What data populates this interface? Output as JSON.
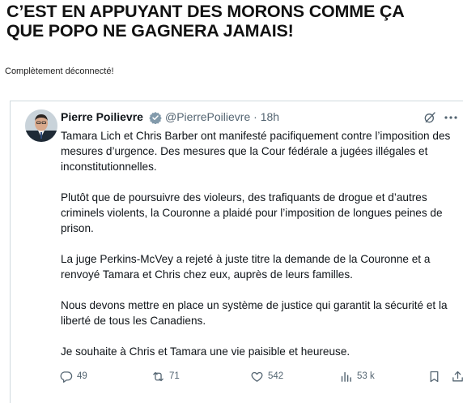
{
  "post": {
    "headline_line1": "C’EST EN APPUYANT DES MORONS COMME ÇA",
    "headline_line2": "QUE POPO NE GAGNERA JAMAIS!",
    "subtitle": "Complètement déconnecté!"
  },
  "tweet": {
    "author_name": "Pierre Poilievre",
    "handle_time": "@PierrePoilievre · 18h",
    "paragraphs": [
      "Tamara Lich et Chris Barber ont manifesté pacifiquement contre l’imposition des mesures d’urgence. Des mesures que la Cour fédérale a jugées illégales et inconstitutionnelles.",
      "Plutôt que de poursuivre des violeurs, des trafiquants de drogue et d’autres criminels violents, la Couronne a plaidé pour l’imposition de longues peines de prison.",
      "La juge Perkins-McVey a rejeté à juste titre la demande de la Couronne et a renvoyé Tamara et Chris chez eux, auprès de leurs familles.",
      "Nous devons mettre en place un système de justice qui garantit la sécurité et la liberté de tous les Canadiens.",
      "Je souhaite à Chris et Tamara une vie paisible et heureuse."
    ],
    "stats": {
      "replies": "49",
      "reposts": "71",
      "likes": "542",
      "views": "53 k"
    }
  },
  "icons": {
    "verified": "verified-badge-icon",
    "grok": "grok-icon",
    "more": "more-icon",
    "reply": "reply-icon",
    "repost": "repost-icon",
    "like": "heart-icon",
    "views": "views-icon",
    "bookmark": "bookmark-icon",
    "share": "share-icon"
  },
  "colors": {
    "verified": "#829aab",
    "muted": "#536471",
    "text": "#0f1419",
    "border": "#cfd9de"
  }
}
